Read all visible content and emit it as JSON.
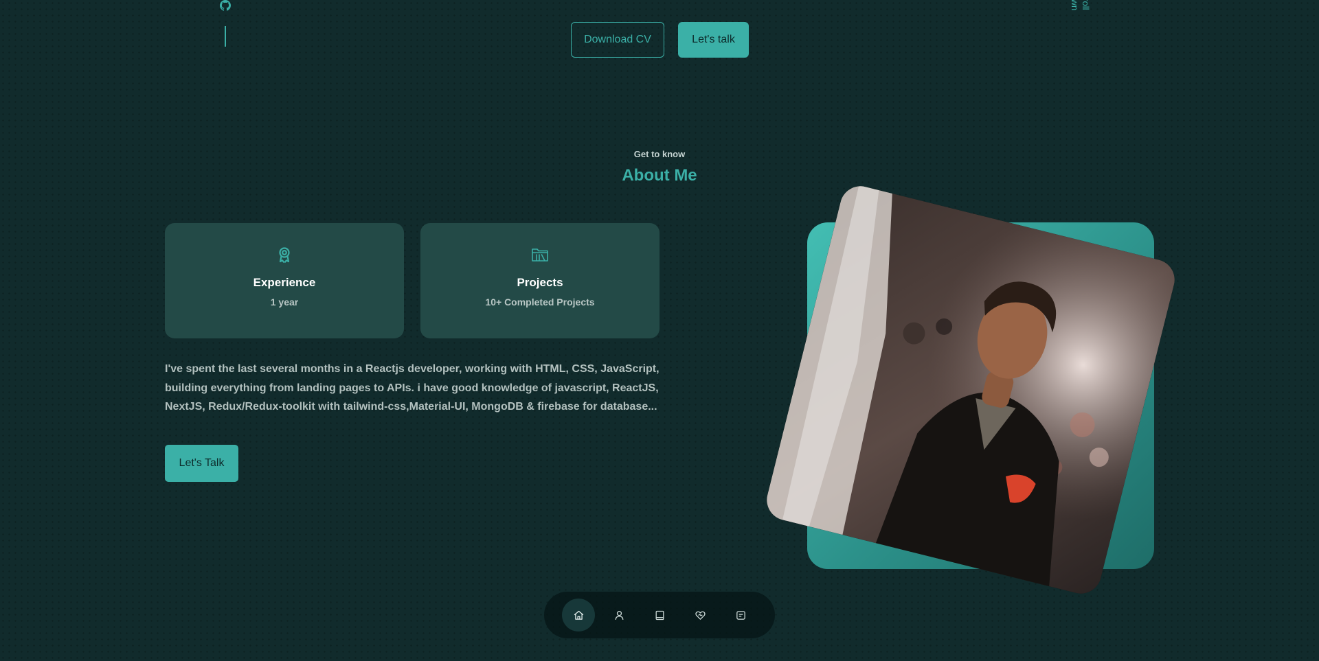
{
  "hero": {
    "download_cv_label": "Download CV",
    "lets_talk_label": "Let's talk",
    "scroll_label": "Scroll Down"
  },
  "about": {
    "subtitle": "Get to know",
    "title": "About Me",
    "cards": [
      {
        "icon": "award-icon",
        "title": "Experience",
        "subtitle": "1 year"
      },
      {
        "icon": "projects-icon",
        "title": "Projects",
        "subtitle": "10+ Completed Projects"
      }
    ],
    "paragraph": "I've spent the last several months in a Reactjs developer, working with HTML, CSS, JavaScript, building everything from landing pages to APIs. i have good knowledge of javascript, ReactJS, NextJS, Redux/Redux-toolkit with tailwind-css,Material-UI, MongoDB & firebase for database...",
    "talk_button_label": "Let's Talk"
  },
  "social": [
    {
      "icon": "github-icon"
    }
  ],
  "nav": {
    "items": [
      {
        "icon": "home-icon",
        "active": true
      },
      {
        "icon": "user-icon",
        "active": false
      },
      {
        "icon": "book-icon",
        "active": false
      },
      {
        "icon": "services-icon",
        "active": false
      },
      {
        "icon": "message-icon",
        "active": false
      }
    ]
  },
  "colors": {
    "background": "#112b2c",
    "accent": "#3bb0a7",
    "card": "#234a47",
    "text_muted": "#b3c1bf"
  }
}
